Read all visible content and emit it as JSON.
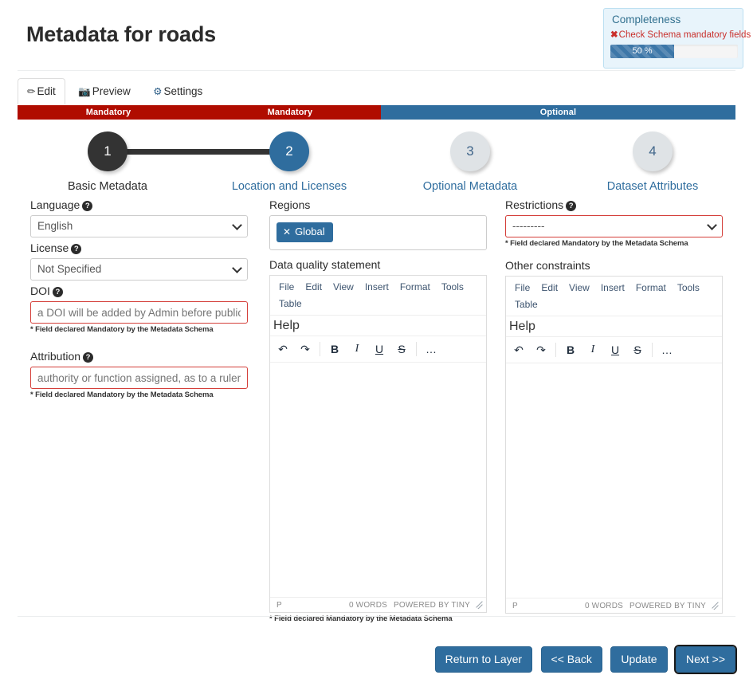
{
  "header": {
    "title": "Metadata for roads"
  },
  "completeness": {
    "title": "Completeness",
    "check_icon": "cross-mark",
    "check_text": "Check Schema mandatory fields",
    "progress_label": "50 %",
    "progress_value": 50,
    "accent_color": "#3d77a8",
    "panel_color": "#e8f4fb",
    "danger_color": "#c9302c"
  },
  "tabs": [
    {
      "label": "Edit",
      "icon": "pencil-icon",
      "active": true
    },
    {
      "label": "Preview",
      "icon": "camera-icon",
      "active": false
    },
    {
      "label": "Settings",
      "icon": "gear-icon",
      "active": false
    }
  ],
  "requirement_bar": {
    "segments": [
      {
        "label": "Mandatory",
        "color": "#b00c00",
        "width_pct": 25.3
      },
      {
        "label": "Mandatory",
        "color": "#b00c00",
        "width_pct": 25.3
      },
      {
        "label": "Optional",
        "color": "#2f6d9e",
        "width_pct": 49.4
      }
    ]
  },
  "stepper": {
    "steps": [
      {
        "number": "1",
        "label": "Basic Metadata",
        "state": "done"
      },
      {
        "number": "2",
        "label": "Location and Licenses",
        "state": "active"
      },
      {
        "number": "3",
        "label": "Optional Metadata",
        "state": "todo"
      },
      {
        "number": "4",
        "label": "Dataset Attributes",
        "state": "todo"
      }
    ]
  },
  "mandatory_note": "* Field declared Mandatory by the Metadata Schema",
  "form": {
    "language": {
      "label": "Language",
      "help_icon": "help-icon",
      "value": "English"
    },
    "license": {
      "label": "License",
      "help_icon": "help-icon",
      "value": "Not Specified"
    },
    "doi": {
      "label": "DOI",
      "help_icon": "help-icon",
      "value": "",
      "placeholder": "a DOI will be added by Admin before publication"
    },
    "attribution": {
      "label": "Attribution",
      "help_icon": "help-icon",
      "value": "",
      "placeholder": "authority or function assigned, as to a ruler, legislative assembly, delegate, or the like."
    },
    "regions": {
      "label": "Regions",
      "tags": [
        {
          "label": "Global",
          "remove_icon": "close-icon"
        }
      ]
    },
    "restrictions": {
      "label": "Restrictions",
      "help_icon": "help-icon",
      "value": "---------"
    },
    "data_quality_statement": {
      "label": "Data quality statement"
    },
    "other_constraints": {
      "label": "Other constraints"
    }
  },
  "editor": {
    "menu_row1": [
      "File",
      "Edit",
      "View",
      "Insert",
      "Format",
      "Tools",
      "Table"
    ],
    "menu_row2": [
      "Help"
    ],
    "toolbar": [
      {
        "name": "undo-icon",
        "glyph": "↶"
      },
      {
        "name": "redo-icon",
        "glyph": "↷"
      },
      {
        "name": "bold-icon",
        "glyph": "B"
      },
      {
        "name": "italic-icon",
        "glyph": "I"
      },
      {
        "name": "underline-icon",
        "glyph": "U"
      },
      {
        "name": "strikethrough-icon",
        "glyph": "S"
      },
      {
        "name": "more-icon",
        "glyph": "…"
      }
    ],
    "status": {
      "path": "p",
      "words": "0 WORDS",
      "brand": "POWERED BY TINY",
      "resize_icon": "resize-handle-icon"
    },
    "content": ""
  },
  "footer": {
    "buttons": [
      {
        "label": "Return to Layer",
        "focused": false
      },
      {
        "label": "<< Back",
        "focused": false
      },
      {
        "label": "Update",
        "focused": false
      },
      {
        "label": "Next >>",
        "focused": true
      }
    ]
  }
}
